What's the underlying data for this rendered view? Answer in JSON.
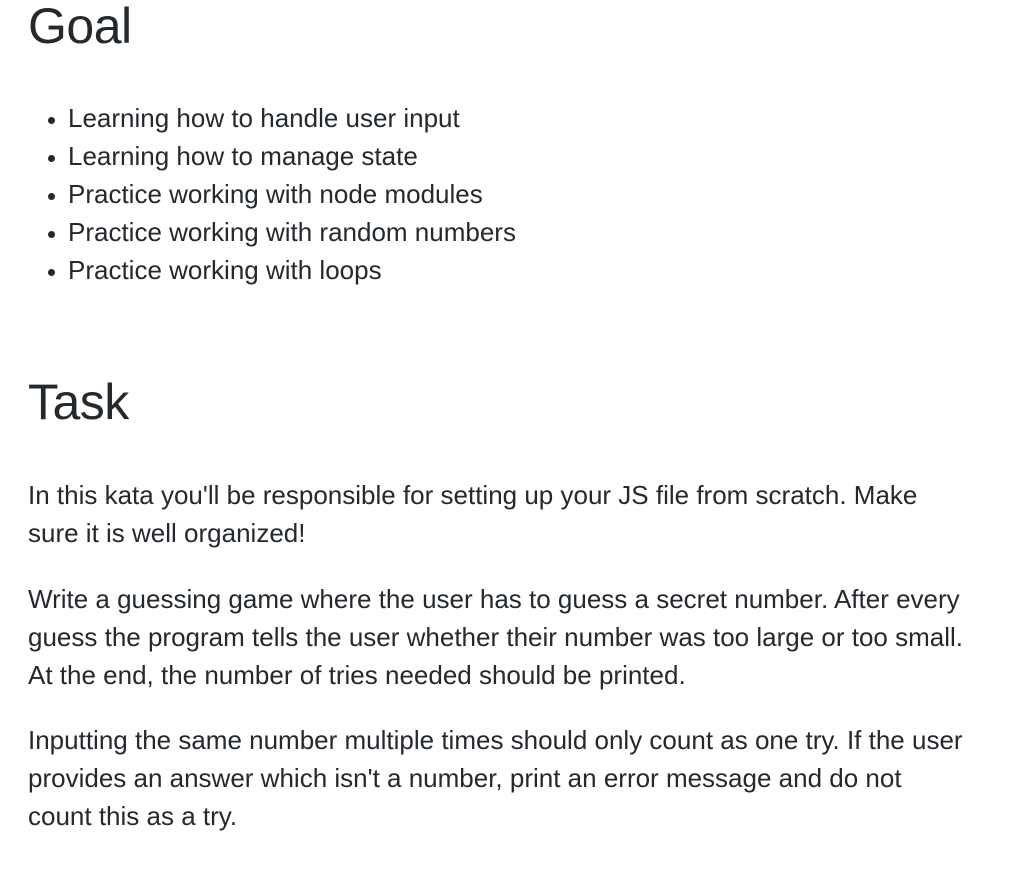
{
  "goal": {
    "heading": "Goal",
    "items": [
      "Learning how to handle user input",
      "Learning how to manage state",
      "Practice working with node modules",
      "Practice working with random numbers",
      "Practice working with loops"
    ]
  },
  "task": {
    "heading": "Task",
    "paragraphs": [
      "In this kata you'll be responsible for setting up your JS file from scratch. Make sure it is well organized!",
      "Write a guessing game where the user has to guess a secret number. After every guess the program tells the user whether their number was too large or too small. At the end, the number of tries needed should be printed.",
      "Inputting the same number multiple times should only count as one try. If the user provides an answer which isn't a number, print an error message and do not count this as a try."
    ]
  }
}
